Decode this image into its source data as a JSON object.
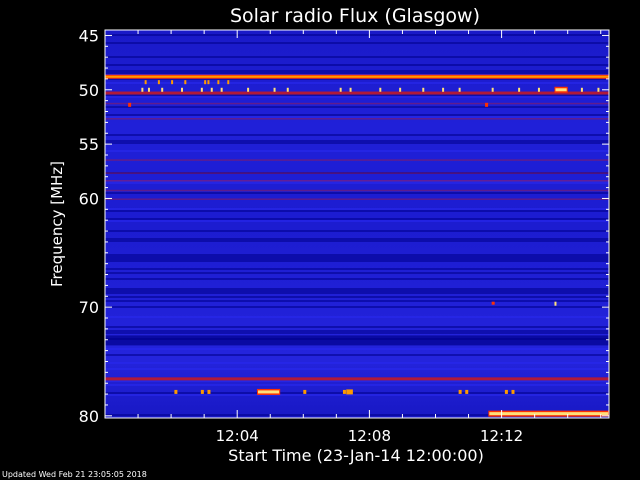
{
  "chart_data": {
    "type": "heatmap",
    "title": "Solar radio Flux (Glasgow)",
    "xlabel": "Start Time (23-Jan-14 12:00:00)",
    "ylabel": "Frequency [MHz]",
    "x_range_minutes": [
      0,
      15.25
    ],
    "y_range_mhz": [
      44.5,
      80.2
    ],
    "x_ticks": [
      {
        "minute": 4,
        "label": "12:04"
      },
      {
        "minute": 8,
        "label": "12:08"
      },
      {
        "minute": 12,
        "label": "12:12"
      }
    ],
    "y_ticks": [
      {
        "mhz": 45,
        "label": "45"
      },
      {
        "mhz": 50,
        "label": "50"
      },
      {
        "mhz": 55,
        "label": "55"
      },
      {
        "mhz": 60,
        "label": "60"
      },
      {
        "mhz": 70,
        "label": "70"
      },
      {
        "mhz": 80,
        "label": "80"
      }
    ],
    "colormap": [
      "#00008a",
      "#1a1ad6",
      "#2a2af0",
      "#b01a3a",
      "#ff3000",
      "#ff9a00",
      "#ffe07a"
    ],
    "emission_lines": [
      {
        "mhz": 48.8,
        "intensity": "high"
      },
      {
        "mhz": 50.3,
        "intensity": "medium"
      },
      {
        "mhz": 76.6,
        "intensity": "medium"
      }
    ],
    "bursts": [
      {
        "start_min": 11.6,
        "end_min": 15.25,
        "mhz": 79.8,
        "intensity": "high"
      },
      {
        "start_min": 13.6,
        "end_min": 14.0,
        "mhz": 50.0,
        "intensity": "high"
      },
      {
        "start_min": 4.6,
        "end_min": 5.3,
        "mhz": 77.8,
        "intensity": "high"
      },
      {
        "start_min": 7.3,
        "end_min": 7.5,
        "mhz": 77.8,
        "intensity": "medium"
      }
    ]
  },
  "footer": {
    "updated": "Updated Wed Feb 21 23:05:05 2018"
  }
}
